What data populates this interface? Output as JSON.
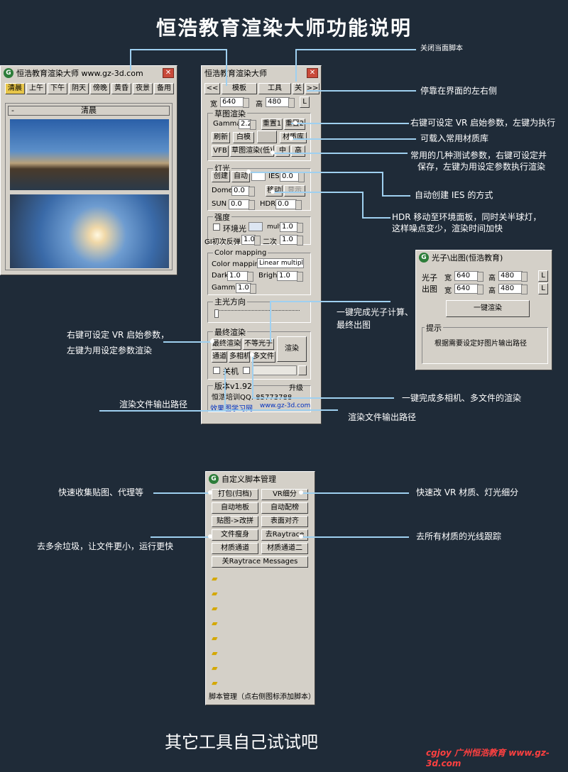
{
  "title": "恒浩教育渲染大师功能说明",
  "footer": "其它工具自己试试吧",
  "watermark": "cgjoy 广州恒浩教育 www.gz-3d.com",
  "left_window": {
    "title": "恒浩教育渲染大师 www.gz-3d.com",
    "tabs": [
      "清晨",
      "上午",
      "下午",
      "阴天",
      "傍晚",
      "黄昏",
      "夜景",
      "备用"
    ],
    "rollout_label": "清晨",
    "rollout_minus": "-"
  },
  "main_window": {
    "title": "恒浩教育渲染大师",
    "nav": {
      "prev": "<<",
      "template": "模板",
      "tools": "工具",
      "close": "关",
      "next": ">>"
    },
    "size": {
      "w_label": "宽",
      "w_val": "640",
      "h_label": "高",
      "h_val": "480",
      "l": "L"
    },
    "draft": {
      "title": "草图渲染",
      "gamma_label": "Gamma",
      "gamma_val": "2.2",
      "reset1": "重置1",
      "reset2": "重置2",
      "refresh": "刷新",
      "white": "白模",
      "matlib": "材质库",
      "vfb": "VFB",
      "draft_low": "草图渲染(低)",
      "mid": "中",
      "high": "高"
    },
    "light": {
      "title": "灯光",
      "create": "创建",
      "auto": "自动",
      "ies_label": "IES",
      "ies_val": "0.0",
      "dome_label": "Dome",
      "dome_val": "0.0",
      "move": "移动",
      "show": "显示",
      "sun_label": "SUN",
      "sun_val": "0.0",
      "hdr_label": "HDR",
      "hdr_val": "0.0"
    },
    "intensity": {
      "title": "强度",
      "env": "环境光",
      "mult_label": "mult",
      "mult_val": "1.0",
      "gi_label": "GI初次反弹",
      "gi_val": "1.0",
      "second_label": "二次",
      "second_val": "1.0"
    },
    "color_mapping": {
      "title": "Color mapping",
      "cm_label": "Color mapping",
      "cm_val": "Linear multipl",
      "dark_label": "Dark",
      "dark_val": "1.0",
      "bright_label": "Bright",
      "bright_val": "1.0",
      "gamma_label": "Gamma",
      "gamma_val": "1.0"
    },
    "main_light": {
      "title": "主光方向"
    },
    "final": {
      "title": "最终渲染",
      "final_render": "最终渲染",
      "no_photon": "不等光子",
      "render": "渲染",
      "channel": "通道",
      "multi_cam": "多相机",
      "multi_file": "多文件",
      "shutdown": "关机"
    },
    "version": {
      "label": "版本v1.92",
      "upgrade": "升级",
      "qq": "恒浩培训QQ: 85773788",
      "site_left": "效果图学习网",
      "site_right": "www.gz-3d.com"
    }
  },
  "photon_window": {
    "title": "光子\\出图(恒浩教育)",
    "photon_label": "光子",
    "output_label": "出图",
    "w_label": "宽",
    "h_label": "高",
    "photon_w": "640",
    "photon_h": "480",
    "output_w": "640",
    "output_h": "480",
    "l": "L",
    "one_click": "一键渲染",
    "tip_title": "提示",
    "tip_text": "根据需要设定好图片输出路径"
  },
  "script_window": {
    "title": "自定义脚本管理",
    "buttons": [
      "打包(归档)",
      "VR细分",
      "自动地板",
      "自动配榜",
      "贴图->改拼",
      "表面对齐",
      "文件瘦身",
      "去Raytrace",
      "材质通道",
      "材质通道二"
    ],
    "wide_button": "关Raytrace Messages",
    "footer": "脚本管理（点右侧图标添加脚本）"
  },
  "annotations": {
    "close_script": "关闭当面脚本",
    "dock": "停靠在界面的左右侧",
    "vr_params": "右键可设定 VR 启始参数，左键为执行",
    "matlib": "可载入常用材质库",
    "test_params_1": "常用的几种测试参数，右键可设定并",
    "test_params_2": "保存，左键为用设定参数执行渲染",
    "ies": "自动创建 IES 的方式",
    "hdr_1": "HDR 移动至环境面板，同时关半球灯，",
    "hdr_2": "这样噪点变少，渲染时间加快",
    "photon_1": "一键完成光子计算、",
    "photon_2": "最终出图",
    "left_vr_1": "右键可设定 VR 启始参数，",
    "left_vr_2": "左键为用设定参数渲染",
    "multi": "一键完成多相机、多文件的渲染",
    "path_left": "渲染文件输出路径",
    "path_right": "渲染文件输出路径",
    "collect": "快速收集贴图、代理等",
    "vr_subdiv": "快速改 VR 材质、灯光细分",
    "slim": "去多余垃圾，让文件更小，运行更快",
    "raytrace": "去所有材质的光线跟踪"
  },
  "colors": {
    "background": "#1f2b38",
    "panel": "#d4d0c8",
    "leader": "#9fd0f0",
    "selected_tab": "#e8c64a"
  }
}
